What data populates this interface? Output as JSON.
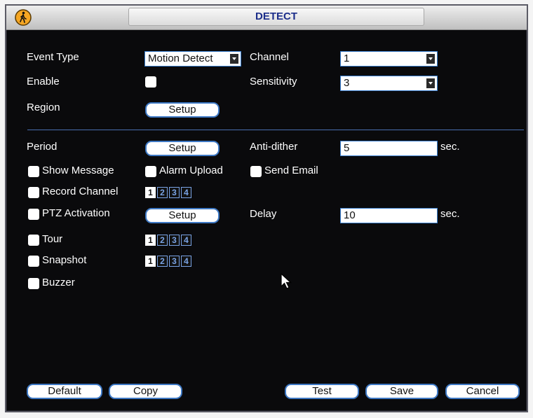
{
  "dialog": {
    "title": "DETECT"
  },
  "event_type": {
    "label": "Event Type",
    "value": "Motion Detect"
  },
  "channel": {
    "label": "Channel",
    "value": "1"
  },
  "enable": {
    "label": "Enable",
    "checked": false
  },
  "sensitivity": {
    "label": "Sensitivity",
    "value": "3"
  },
  "region": {
    "label": "Region",
    "button": "Setup"
  },
  "period": {
    "label": "Period",
    "button": "Setup"
  },
  "anti_dither": {
    "label": "Anti-dither",
    "value": "5",
    "unit": "sec."
  },
  "show_message": {
    "label": "Show Message",
    "checked": false
  },
  "alarm_upload": {
    "label": "Alarm Upload",
    "checked": false
  },
  "send_email": {
    "label": "Send Email",
    "checked": false
  },
  "record_channel": {
    "label": "Record Channel",
    "checked": false,
    "channels": [
      "1",
      "2",
      "3",
      "4"
    ],
    "selected": [
      1
    ]
  },
  "ptz_activation": {
    "label": "PTZ Activation",
    "checked": false,
    "button": "Setup"
  },
  "delay": {
    "label": "Delay",
    "value": "10",
    "unit": "sec."
  },
  "tour": {
    "label": "Tour",
    "checked": false,
    "channels": [
      "1",
      "2",
      "3",
      "4"
    ],
    "selected": [
      1
    ]
  },
  "snapshot": {
    "label": "Snapshot",
    "checked": false,
    "channels": [
      "1",
      "2",
      "3",
      "4"
    ],
    "selected": [
      1
    ]
  },
  "buzzer": {
    "label": "Buzzer",
    "checked": false
  },
  "footer": {
    "default": "Default",
    "copy": "Copy",
    "test": "Test",
    "save": "Save",
    "cancel": "Cancel"
  },
  "icons": {
    "logo": "pedestrian-sign-icon",
    "cursor": "mouse-pointer-icon"
  },
  "colors": {
    "background": "#0a0a0c",
    "title_text": "#1c2e8a",
    "accent": "#3d78c4"
  }
}
